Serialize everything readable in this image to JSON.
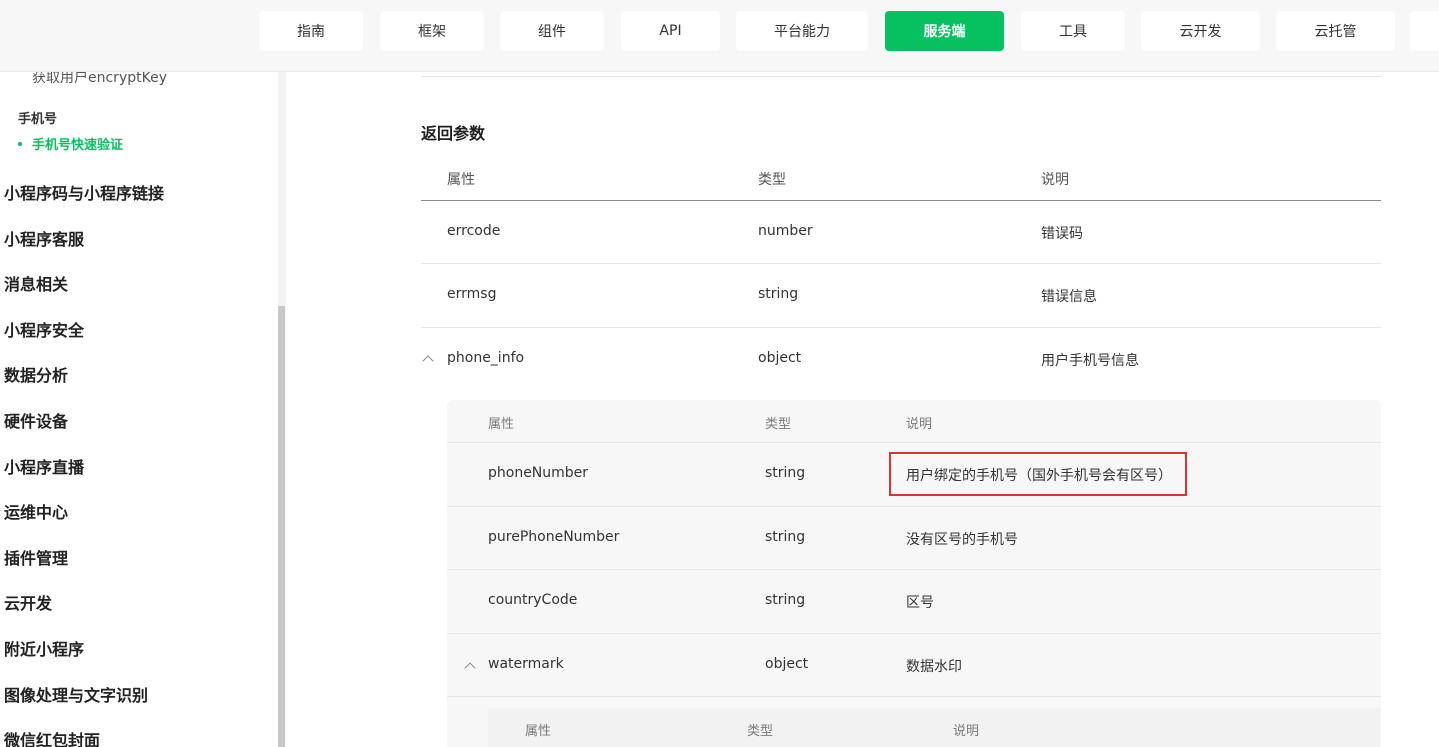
{
  "nav": {
    "items": [
      "指南",
      "框架",
      "组件",
      "API",
      "平台能力",
      "服务端",
      "工具",
      "云开发",
      "云托管"
    ],
    "active": "服务端",
    "accent_color": "#07c160"
  },
  "sidebar": {
    "sub_item_top": "获取用户encryptKey",
    "group_label": "手机号",
    "active_item": "手机号快速验证",
    "items": [
      "小程序码与小程序链接",
      "小程序客服",
      "消息相关",
      "小程序安全",
      "数据分析",
      "硬件设备",
      "小程序直播",
      "运维中心",
      "插件管理",
      "云开发",
      "附近小程序",
      "图像处理与文字识别",
      "微信红包封面"
    ]
  },
  "main": {
    "section_title": "返回参数",
    "headers": [
      "属性",
      "类型",
      "说明"
    ],
    "rows": [
      {
        "name": "errcode",
        "type": "number",
        "desc": "错误码"
      },
      {
        "name": "errmsg",
        "type": "string",
        "desc": "错误信息"
      },
      {
        "name": "phone_info",
        "type": "object",
        "desc": "用户手机号信息",
        "expanded": true
      }
    ],
    "nested": {
      "headers": [
        "属性",
        "类型",
        "说明"
      ],
      "rows": [
        {
          "name": "phoneNumber",
          "type": "string",
          "desc": "用户绑定的手机号（国外手机号会有区号）",
          "highlighted": true
        },
        {
          "name": "purePhoneNumber",
          "type": "string",
          "desc": "没有区号的手机号"
        },
        {
          "name": "countryCode",
          "type": "string",
          "desc": "区号"
        },
        {
          "name": "watermark",
          "type": "object",
          "desc": "数据水印",
          "expanded": true
        }
      ],
      "nested2": {
        "headers": [
          "属性",
          "类型",
          "说明"
        ]
      }
    },
    "highlight_color": "#e03030"
  }
}
